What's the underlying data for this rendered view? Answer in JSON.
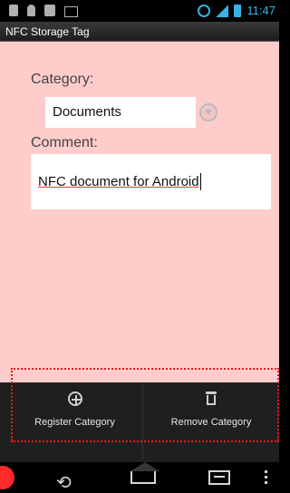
{
  "status_bar": {
    "time": "11:47",
    "icons": [
      "nfc-icon",
      "usb-icon",
      "shopping-bag-icon",
      "gmail-icon",
      "sync-icon",
      "signal-icon",
      "battery-icon"
    ]
  },
  "app": {
    "title": "NFC Storage Tag"
  },
  "form": {
    "category_label": "Category:",
    "category_value": "Documents",
    "comment_label": "Comment:",
    "comment_value": "NFC document for Android"
  },
  "actions": {
    "register_label": "Register Category",
    "remove_label": "Remove Category"
  },
  "colors": {
    "content_background": "#ffcccc",
    "accent_blue": "#38b2e6",
    "highlight_red": "#e21b1b"
  }
}
